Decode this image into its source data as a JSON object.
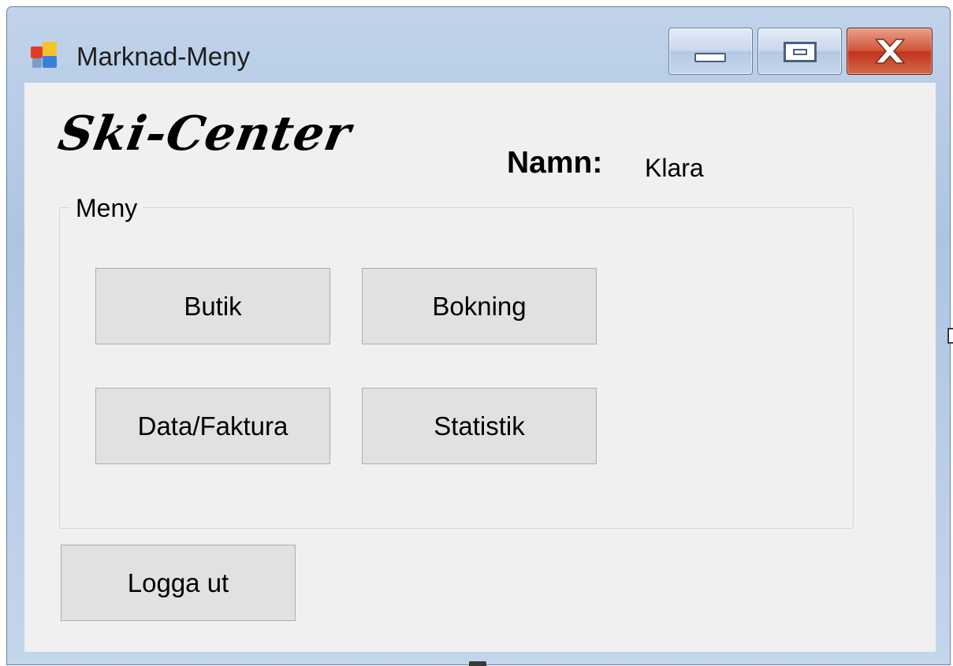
{
  "window": {
    "title": "Marknad-Meny",
    "icons": {
      "app": "windows-forms-app-icon",
      "minimize": "minimize-icon",
      "maximize": "maximize-icon",
      "close": "close-icon"
    },
    "colors": {
      "frame": "#b9cde6",
      "client_background": "#f0f0f0",
      "close_button": "#c7432a"
    }
  },
  "header": {
    "logo_text": "Ski-Center",
    "name_label": "Namn:",
    "name_value": "Klara"
  },
  "menu_group": {
    "legend": "Meny",
    "buttons": [
      {
        "label": "Butik"
      },
      {
        "label": "Bokning"
      },
      {
        "label": "Data/Faktura"
      },
      {
        "label": "Statistik"
      }
    ]
  },
  "footer": {
    "logout_label": "Logga ut"
  }
}
